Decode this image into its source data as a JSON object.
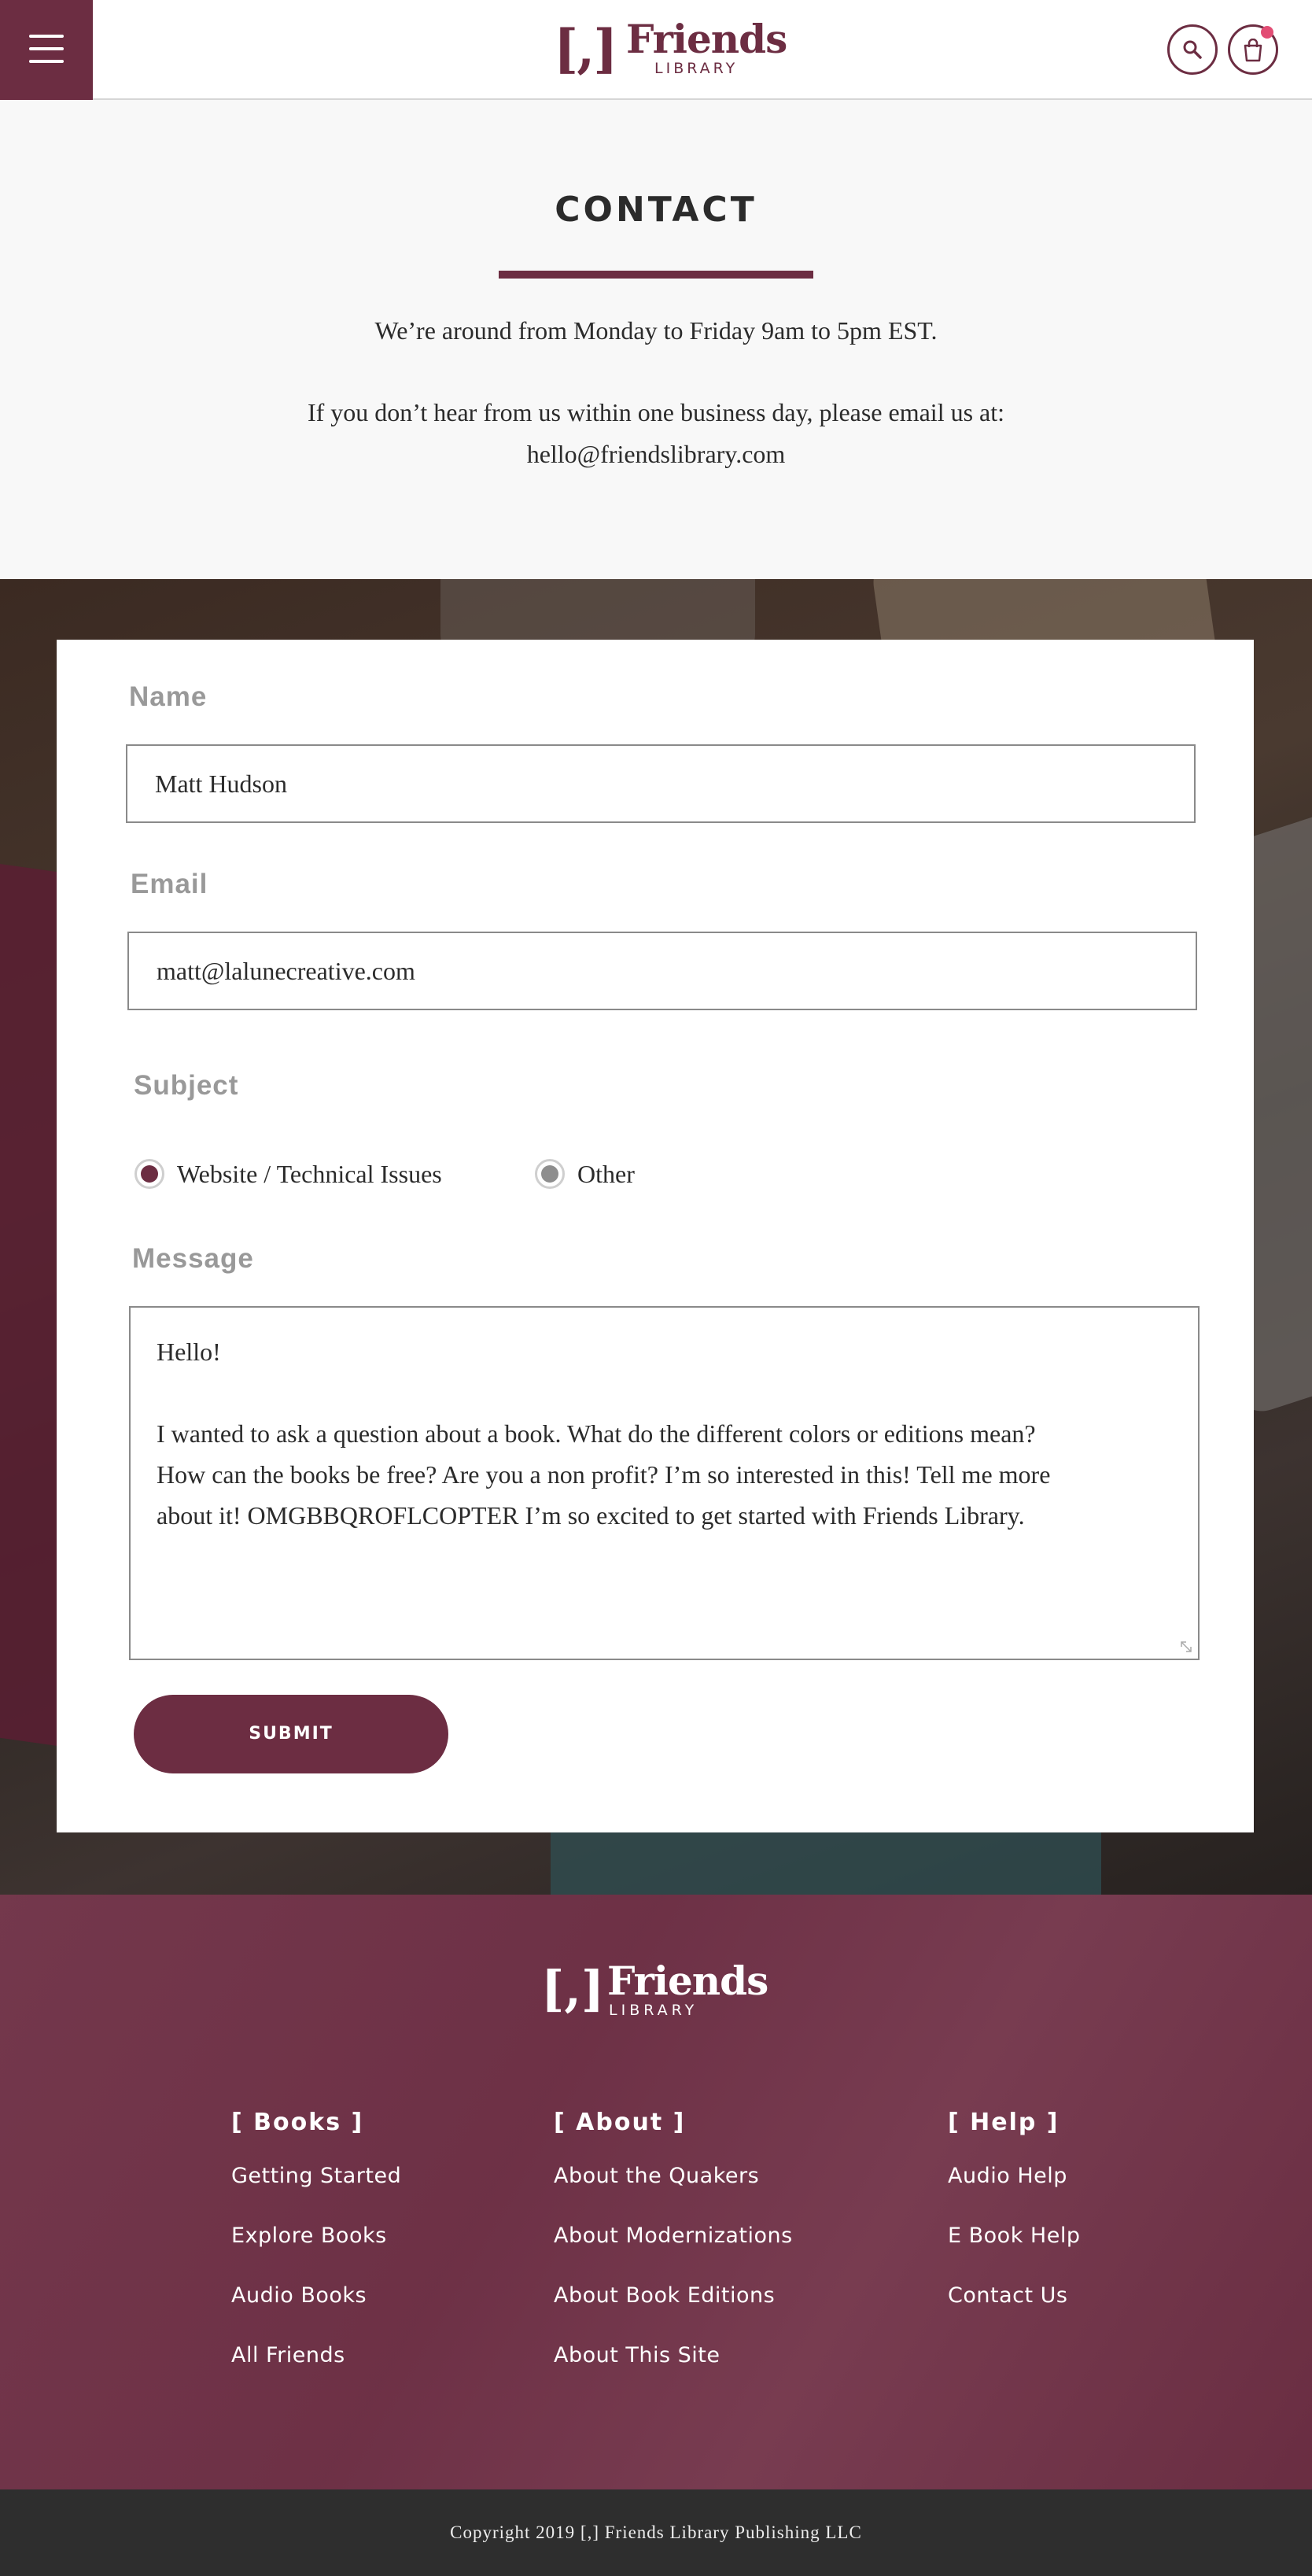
{
  "header": {
    "logo": {
      "bracket": "[,]",
      "name": "Friends",
      "sub": "LIBRARY"
    },
    "icons": {
      "menu": "hamburger-menu-icon",
      "search": "search-icon",
      "cart": "shopping-bag-icon"
    }
  },
  "contact": {
    "title": "CONTACT",
    "hours": "We’re around from Monday to Friday 9am to 5pm EST.",
    "note": "If you don’t hear from us within one business day, please email us at:",
    "email": "hello@friendslibrary.com"
  },
  "form": {
    "name_label": "Name",
    "name_value": "Matt Hudson",
    "email_label": "Email",
    "email_value": "matt@lalunecreative.com",
    "subject_label": "Subject",
    "subject_options": [
      {
        "label": "Website / Technical Issues",
        "selected": true
      },
      {
        "label": "Other",
        "selected": false
      }
    ],
    "message_label": "Message",
    "message_lines": [
      "Hello!",
      "I wanted to ask a question about a book. What do the different colors or editions mean?",
      "How can the books be free? Are you a non profit? I’m so interested in this! Tell me more",
      "about it! OMGBBQROFLCOPTER I’m so excited to get started with Friends Library."
    ],
    "submit_label": "SUBMIT"
  },
  "footer": {
    "logo": {
      "bracket": "[,]",
      "name": "Friends",
      "sub": "LIBRARY"
    },
    "columns": [
      {
        "heading": "[ Books ]",
        "links": [
          "Getting Started",
          "Explore Books",
          "Audio Books",
          "All Friends"
        ]
      },
      {
        "heading": "[ About ]",
        "links": [
          "About the Quakers",
          "About Modernizations",
          "About Book Editions",
          "About This Site"
        ]
      },
      {
        "heading": "[ Help ]",
        "links": [
          "Audio Help",
          "E Book Help",
          "Contact Us"
        ]
      }
    ],
    "copyright": "Copyright 2019 [,] Friends Library Publishing LLC"
  },
  "colors": {
    "brand": "#6c2d42",
    "footer": "#6d3146",
    "copyright_bg": "#2e2e2e",
    "radio_selected": "#6c2d42",
    "radio_unselected": "#8e8e8e"
  }
}
